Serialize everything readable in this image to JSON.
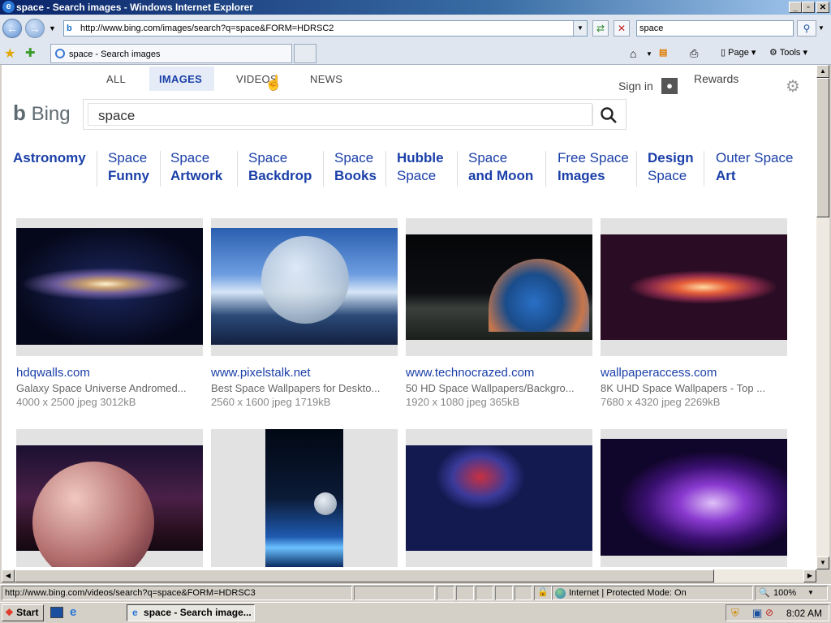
{
  "window": {
    "title": "space - Search images - Windows Internet Explorer"
  },
  "nav": {
    "back_icon": "back-arrow-icon",
    "address": "http://www.bing.com/images/search?q=space&FORM=HDRSC2",
    "search_value": "space"
  },
  "tab": {
    "label": "space - Search images"
  },
  "commands": {
    "page": "Page",
    "tools": "Tools"
  },
  "bing": {
    "tabs": [
      {
        "label": "ALL"
      },
      {
        "label": "IMAGES"
      },
      {
        "label": "VIDEOS"
      },
      {
        "label": "NEWS"
      }
    ],
    "sign_in": "Sign in",
    "rewards": "Rewards",
    "logo": "Bing",
    "query": "space",
    "related": [
      {
        "line1": "Astronomy",
        "line2": ""
      },
      {
        "line1": "Space",
        "line2": "Funny"
      },
      {
        "line1": "Space",
        "line2": "Artwork"
      },
      {
        "line1": "Space",
        "line2": "Backdrop"
      },
      {
        "line1": "Space",
        "line2": "Books"
      },
      {
        "line1": "Hubble",
        "line2": "Space"
      },
      {
        "line1": "Space",
        "line2": "and Moon"
      },
      {
        "line1": "Free Space",
        "line2": "Images"
      },
      {
        "line1": "Design",
        "line2": "Space"
      },
      {
        "line1": "Outer Space",
        "line2": "Art"
      }
    ],
    "results": [
      {
        "source": "hdqwalls.com",
        "desc": "Galaxy Space Universe Andromed...",
        "meta": "4000 x 2500 jpeg 3012kB"
      },
      {
        "source": "www.pixelstalk.net",
        "desc": "Best Space Wallpapers for Deskto...",
        "meta": "2560 x 1600 jpeg 1719kB"
      },
      {
        "source": "www.technocrazed.com",
        "desc": "50 HD Space Wallpapers/Backgro...",
        "meta": "1920 x 1080 jpeg 365kB"
      },
      {
        "source": "wallpaperaccess.com",
        "desc": "8K UHD Space Wallpapers - Top ...",
        "meta": "7680 x 4320 jpeg 2269kB"
      }
    ]
  },
  "status": {
    "url": "http://www.bing.com/videos/search?q=space&FORM=HDRSC3",
    "zone": "Internet | Protected Mode: On",
    "zoom": "100%"
  },
  "taskbar": {
    "start": "Start",
    "item": "space - Search image...",
    "clock": "8:02 AM"
  }
}
